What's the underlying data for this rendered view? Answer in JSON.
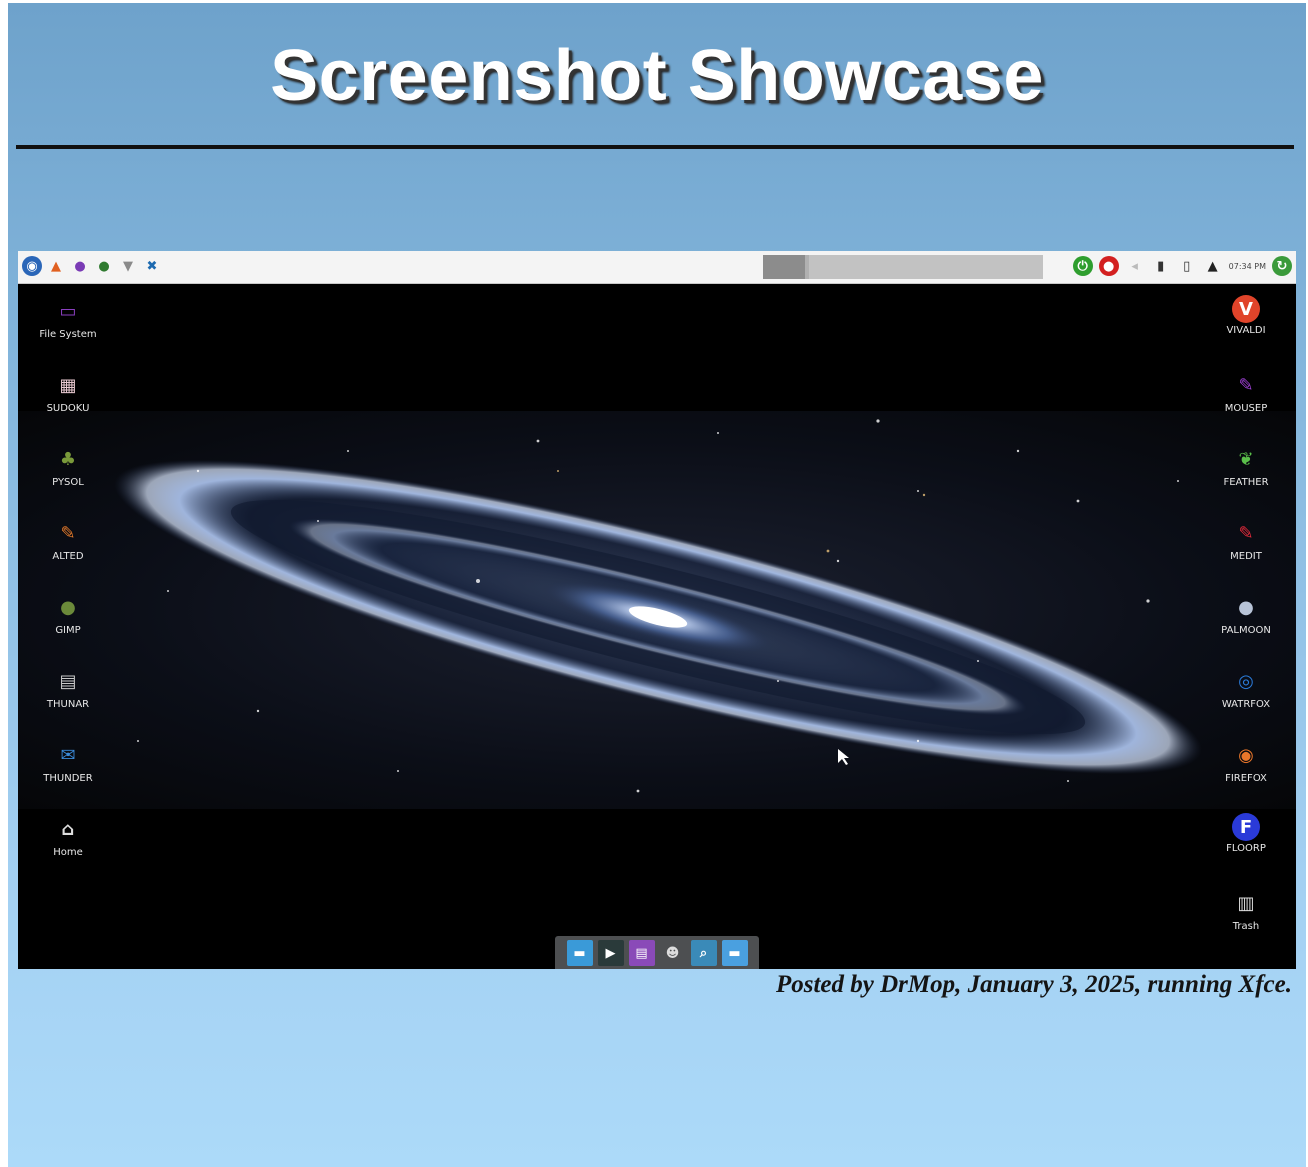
{
  "page": {
    "title": "Screenshot Showcase",
    "caption": "Posted by DrMop, January 3, 2025, running Xfce."
  },
  "colors": {
    "background_top": "#6ea2cb",
    "background_bottom": "#acdaf9",
    "title_text": "#ffffff",
    "caption_text": "#141414",
    "desktop_background": "#000000",
    "panel_background": "#f4f4f4"
  },
  "screenshot": {
    "wallpaper": "spiral galaxy (Andromeda) on black starfield",
    "top_panel": {
      "left_launchers": [
        {
          "name": "app-menu-icon",
          "glyph": "◉",
          "color": "#2a66b8"
        },
        {
          "name": "triangle-app-icon",
          "glyph": "▲",
          "color": "#e06020"
        },
        {
          "name": "purple-orb-icon",
          "glyph": "●",
          "color": "#7a3bb5"
        },
        {
          "name": "globe-icon",
          "glyph": "●",
          "color": "#2f7a2f"
        },
        {
          "name": "filter-icon",
          "glyph": "▼",
          "color": "#8a8a8a"
        },
        {
          "name": "tools-icon",
          "glyph": "✖",
          "color": "#1d6ab0"
        }
      ],
      "tray": [
        {
          "name": "power-icon",
          "glyph": "⏻",
          "color": "#2e9e2e"
        },
        {
          "name": "record-icon",
          "glyph": "●",
          "color": "#d32020"
        },
        {
          "name": "volume-icon",
          "glyph": "◂",
          "color": "#bbbbbb"
        },
        {
          "name": "clipboard-icon",
          "glyph": "▮",
          "color": "#333333"
        },
        {
          "name": "battery-icon",
          "glyph": "▯",
          "color": "#333333"
        },
        {
          "name": "bell-icon",
          "glyph": "▲",
          "color": "#222222"
        }
      ],
      "clock": "07:34 PM",
      "logout_icon": {
        "name": "refresh-icon",
        "glyph": "↻",
        "color": "#3a9a3a"
      }
    },
    "desktop_icons_left": [
      {
        "label": "File System",
        "icon": "file-system-icon",
        "glyph": "▭",
        "color": "#8a3fbf"
      },
      {
        "label": "SUDOKU",
        "icon": "sudoku-icon",
        "glyph": "▦",
        "color": "#e8c8d0"
      },
      {
        "label": "PYSOL",
        "icon": "pysol-icon",
        "glyph": "♣",
        "color": "#7a9a3a"
      },
      {
        "label": "ALTED",
        "icon": "alted-icon",
        "glyph": "✎",
        "color": "#e0782a"
      },
      {
        "label": "GIMP",
        "icon": "gimp-icon",
        "glyph": "●",
        "color": "#6b8a3a"
      },
      {
        "label": "THUNAR",
        "icon": "thunar-icon",
        "glyph": "▤",
        "color": "#c9c9c9"
      },
      {
        "label": "THUNDER",
        "icon": "thunderbird-icon",
        "glyph": "✉",
        "color": "#3a8ad8"
      },
      {
        "label": "Home",
        "icon": "home-icon",
        "glyph": "⌂",
        "color": "#dddddd"
      }
    ],
    "desktop_icons_right": [
      {
        "label": "VIVALDI",
        "icon": "vivaldi-icon",
        "glyph": "V",
        "color": "#e0442a"
      },
      {
        "label": "MOUSEP",
        "icon": "mousepad-icon",
        "glyph": "✎",
        "color": "#9a3fcf"
      },
      {
        "label": "FEATHER",
        "icon": "feather-icon",
        "glyph": "❦",
        "color": "#5abf4a"
      },
      {
        "label": "MEDIT",
        "icon": "medit-icon",
        "glyph": "✎",
        "color": "#e02a3a"
      },
      {
        "label": "PALMOON",
        "icon": "palemoon-icon",
        "glyph": "●",
        "color": "#b8c4d8"
      },
      {
        "label": "WATRFOX",
        "icon": "waterfox-icon",
        "glyph": "◎",
        "color": "#2a7ad8"
      },
      {
        "label": "FIREFOX",
        "icon": "firefox-icon",
        "glyph": "◉",
        "color": "#e8762a"
      },
      {
        "label": "FLOORP",
        "icon": "floorp-icon",
        "glyph": "F",
        "color": "#2a3ad8"
      },
      {
        "label": "Trash",
        "icon": "trash-icon",
        "glyph": "▥",
        "color": "#dcdcdc"
      }
    ],
    "dock": [
      {
        "icon": "show-desktop-icon",
        "glyph": "▬",
        "color": "#3a9ad8"
      },
      {
        "icon": "terminal-icon",
        "glyph": "▶",
        "color": "#2a3a3a"
      },
      {
        "icon": "workspace-icon",
        "glyph": "▤",
        "color": "#8a4ab8"
      },
      {
        "icon": "agent-icon",
        "glyph": "☻",
        "color": "#555555"
      },
      {
        "icon": "search-icon",
        "glyph": "⌕",
        "color": "#3a8ab8"
      },
      {
        "icon": "folder-icon",
        "glyph": "▬",
        "color": "#4aa0e0"
      }
    ]
  }
}
